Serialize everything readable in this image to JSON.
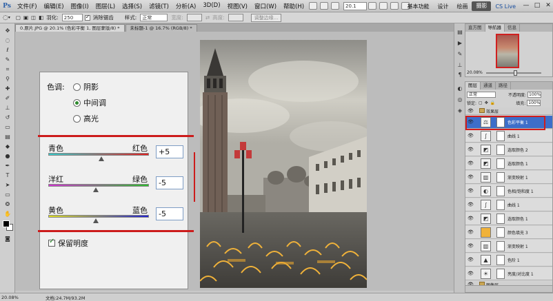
{
  "app": {
    "logo": "Ps",
    "menus": [
      "文件(F)",
      "编辑(E)",
      "图像(I)",
      "图层(L)",
      "选择(S)",
      "滤镜(T)",
      "分析(A)",
      "3D(D)",
      "视图(V)",
      "窗口(W)",
      "帮助(H)"
    ],
    "zoom": "20.1",
    "workspaces": [
      "基本功能",
      "设计",
      "绘画",
      "摄影"
    ],
    "active_workspace": "摄影",
    "cs_live": "CS Live",
    "window_controls": [
      "—",
      "□",
      "✕"
    ]
  },
  "options": {
    "feather_label": "羽化:",
    "feather_value": "250 px",
    "antialias_label": "消除锯齿",
    "style_label": "样式:",
    "style_value": "正常",
    "width_label": "宽度:",
    "height_label": "高度:",
    "refine_button": "调整边缘..."
  },
  "document_tabs": [
    "0.原片.JPG @ 20.1% (色彩平衡 1, 图层蒙版/8) *",
    "未标题-1 @ 16.7% (RGB/8) *"
  ],
  "color_balance": {
    "tone_label": "色调:",
    "tones": [
      "阴影",
      "中间调",
      "高光"
    ],
    "selected_tone": "中间调",
    "sliders": [
      {
        "left": "青色",
        "right": "红色",
        "value": "+5",
        "level": 5,
        "gradient": [
          "#35c9c9",
          "#e02020"
        ]
      },
      {
        "left": "洋红",
        "right": "绿色",
        "value": "-5",
        "level": -5,
        "gradient": [
          "#d233d2",
          "#2bbd2b"
        ]
      },
      {
        "left": "黄色",
        "right": "蓝色",
        "value": "-5",
        "level": -5,
        "gradient": [
          "#e0e020",
          "#2020d0"
        ]
      }
    ],
    "preserve_label": "保留明度",
    "preserve_checked": true
  },
  "status": {
    "zoom": "20.08%",
    "doc": "文档:24.7M/93.2M"
  },
  "navigator": {
    "tabs": [
      "直方图",
      "导航器",
      "信息"
    ],
    "active_tab": "导航器",
    "zoom": "20.08%"
  },
  "layers": {
    "tabs": [
      "图层",
      "通道",
      "路径"
    ],
    "active_tab": "图层",
    "blend_mode": "正常",
    "opacity_label": "不透明度:",
    "opacity": "100%",
    "lock_label": "锁定:",
    "fill_label": "填充:",
    "fill": "100%",
    "group_top": "效果层",
    "group_bottom": "图像层",
    "items": [
      {
        "name": "色彩平衡 1",
        "icon": "⚖",
        "selected": true
      },
      {
        "name": "曲线 1",
        "icon": "∫",
        "selected": false
      },
      {
        "name": "选取颜色 2",
        "icon": "◩",
        "selected": false
      },
      {
        "name": "选取颜色 1",
        "icon": "◩",
        "selected": false
      },
      {
        "name": "渐变映射 1",
        "icon": "▥",
        "selected": false
      },
      {
        "name": "色相/饱和度 1",
        "icon": "◐",
        "selected": false
      },
      {
        "name": "曲线 1",
        "icon": "∫",
        "selected": false
      },
      {
        "name": "选取颜色 1",
        "icon": "◩",
        "selected": false
      },
      {
        "name": "颜色填充 3",
        "icon": "■",
        "selected": false,
        "color": "#f0b23a"
      },
      {
        "name": "渐变映射 1",
        "icon": "▥",
        "selected": false
      },
      {
        "name": "色阶 1",
        "icon": "▲",
        "selected": false
      },
      {
        "name": "亮度/对比度 1",
        "icon": "☀",
        "selected": false
      }
    ]
  },
  "colors": {
    "accent": "#3d6ec9",
    "highlight_red": "#cc1b1b"
  }
}
